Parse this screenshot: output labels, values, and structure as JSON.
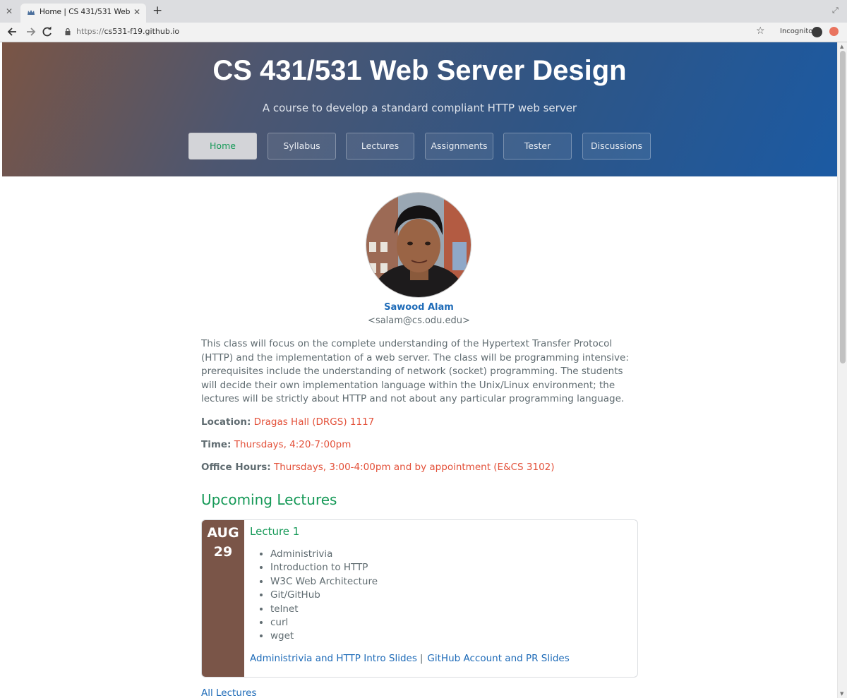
{
  "browser": {
    "tab_title": "Home | CS 431/531 Web Serve",
    "url_protocol": "https://",
    "url_host": "cs531-f19.github.io",
    "incognito_label": "Incognito"
  },
  "site": {
    "title": "CS 431/531 Web Server Design",
    "subtitle": "A course to develop a standard compliant HTTP web server",
    "nav": [
      "Home",
      "Syllabus",
      "Lectures",
      "Assignments",
      "Tester",
      "Discussions"
    ],
    "active_nav": "Home"
  },
  "instructor": {
    "name": "Sawood Alam",
    "email": "<salam@cs.odu.edu>"
  },
  "intro": "This class will focus on the complete understanding of the Hypertext Transfer Protocol (HTTP) and the implementation of a web server. The class will be programming intensive: prerequisites include the understanding of network (socket) programming. The students will decide their own implementation language within the Unix/Linux environment; the lectures will be strictly about HTTP and not about any particular programming language.",
  "info": {
    "location_label": "Location:",
    "location_value": "Dragas Hall (DRGS) 1117",
    "time_label": "Time:",
    "time_value": "Thursdays, 4:20-7:00pm",
    "office_label": "Office Hours:",
    "office_value": "Thursdays, 3:00-4:00pm and by appointment (E&CS 3102)"
  },
  "upcoming_heading": "Upcoming Lectures",
  "lecture": {
    "month": "AUG",
    "day": "29",
    "title": "Lecture 1",
    "topics": [
      "Administrivia",
      "Introduction to HTTP",
      "W3C Web Architecture",
      "Git/GitHub",
      "telnet",
      "curl",
      "wget"
    ],
    "slides": [
      "Administrivia and HTTP Intro Slides",
      "GitHub Account and PR Slides"
    ],
    "separator": "|"
  },
  "all_lectures_link": "All Lectures",
  "colors": {
    "link": "#1e6bb8",
    "accent_green": "#159957",
    "info_red": "#e3513a",
    "date_box": "#7a5548"
  }
}
